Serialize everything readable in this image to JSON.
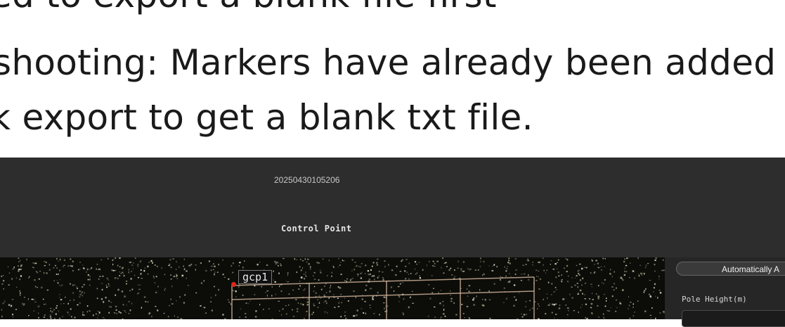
{
  "document": {
    "lines": [
      "ed to export a blank file first",
      "shooting: Markers have already been added d",
      "k export to get a blank txt file."
    ]
  },
  "app": {
    "title": "20250430105206",
    "subtitle": "Control Point",
    "viewport": {
      "marker_label": "gcp1"
    },
    "side_panel": {
      "auto_button_label": "Automatically A",
      "pole_height_label": "Pole Height(m)"
    }
  }
}
